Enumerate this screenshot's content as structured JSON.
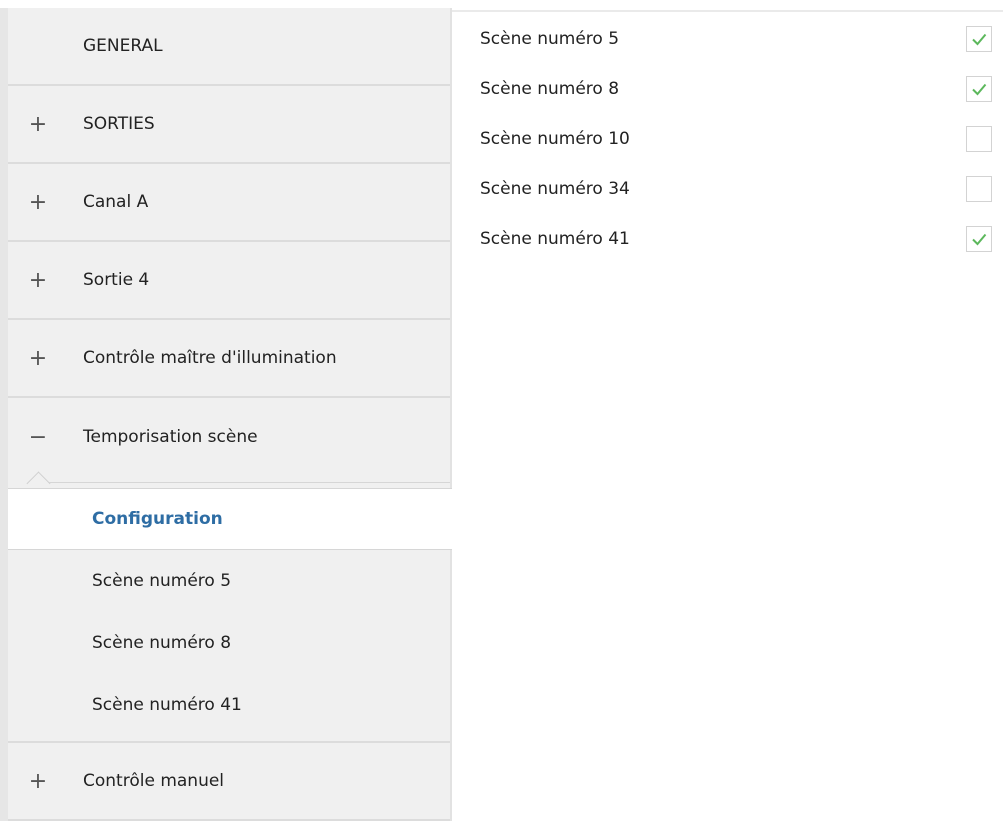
{
  "sidebar": {
    "items": [
      {
        "sign": "",
        "label": "GENERAL"
      },
      {
        "sign": "+",
        "label": "SORTIES"
      },
      {
        "sign": "+",
        "label": "Canal A"
      },
      {
        "sign": "+",
        "label": "Sortie 4"
      },
      {
        "sign": "+",
        "label": "Contrôle maître d'illumination"
      },
      {
        "sign": "−",
        "label": "Temporisation scène"
      }
    ],
    "sub_items": [
      {
        "label": "Configuration",
        "active": true
      },
      {
        "label": "Scène numéro 5"
      },
      {
        "label": "Scène numéro 8"
      },
      {
        "label": "Scène numéro 41"
      }
    ],
    "last_item": {
      "sign": "+",
      "label": "Contrôle manuel"
    }
  },
  "scenes": [
    {
      "label": "Scène numéro 5",
      "checked": true
    },
    {
      "label": "Scène numéro 8",
      "checked": true
    },
    {
      "label": "Scène numéro 10",
      "checked": false
    },
    {
      "label": "Scène numéro 34",
      "checked": false
    },
    {
      "label": "Scène numéro 41",
      "checked": true
    }
  ],
  "colors": {
    "accent": "#2e6da4",
    "check": "#5cb85c"
  }
}
